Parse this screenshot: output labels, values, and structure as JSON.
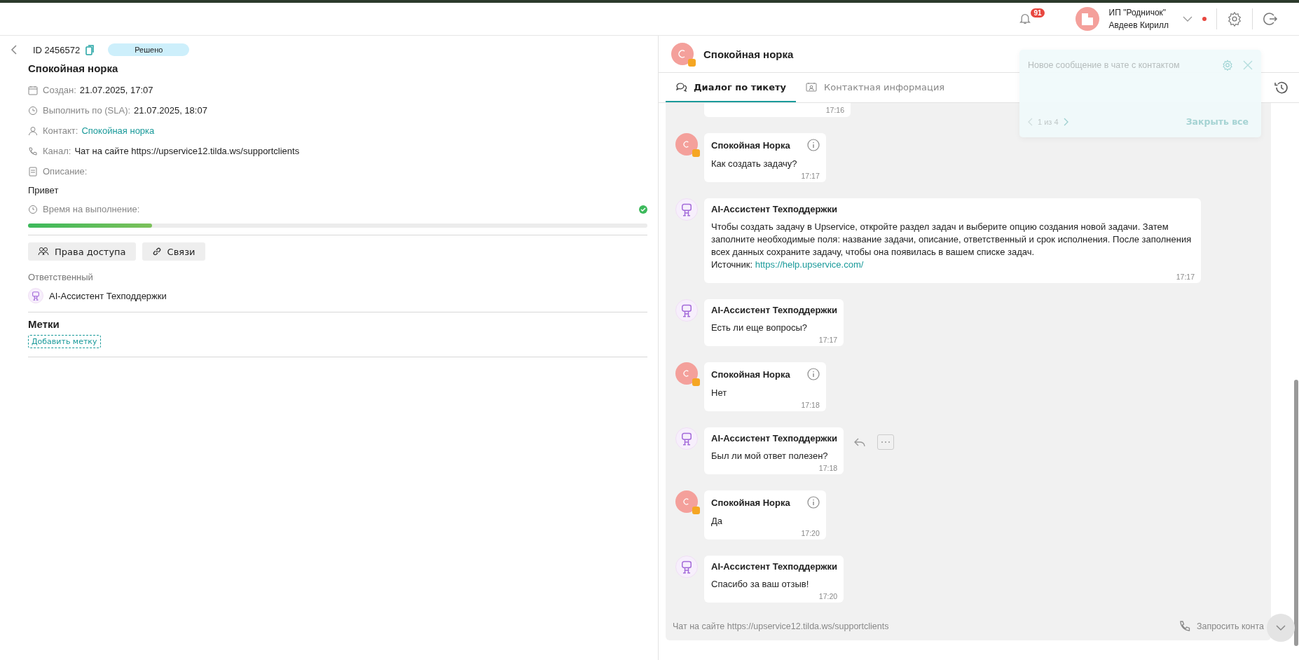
{
  "header": {
    "notifications": "91",
    "company": "ИП \"Родничок\"",
    "user": "Авдеев Кирилл",
    "online": true
  },
  "ticket": {
    "id": "ID 2456572",
    "status": "Решено",
    "title": "Спокойная норка",
    "fields": [
      {
        "label": "Создан:",
        "value": "21.07.2025, 17:07",
        "link": false
      },
      {
        "label": "Выполнить по (SLA):",
        "value": "21.07.2025, 18:07",
        "link": false
      },
      {
        "label": "Контакт:",
        "value": "Спокойная норка",
        "link": true
      },
      {
        "label": "Канал:",
        "value": "Чат на сайте https://upservice12.tilda.ws/supportclients",
        "link": false
      },
      {
        "label": "Описание:"
      }
    ],
    "description": "Привет",
    "progress": {
      "label": "Время на выполнение:",
      "done": true,
      "level": 0.2
    },
    "buttons": [
      "Права доступа",
      "Связи"
    ],
    "responsible_label": "Ответственный",
    "responsible": "AI-Ассистент Техподдержки",
    "tags_title": "Метки",
    "add_tag": "Добавить метку"
  },
  "chat": {
    "contact": "Спокойная норка",
    "tabs": [
      {
        "label": "Диалог по тикету",
        "selected": true
      },
      {
        "label": "Контактная информация",
        "selected": false
      }
    ],
    "messages": [
      {
        "kind": "partial",
        "time": "17:16"
      },
      {
        "kind": "contact",
        "name": "Спокойная Норка",
        "text": "Как создать задачу?",
        "time": "17:17"
      },
      {
        "kind": "ai",
        "name": "AI-Ассистент Техподдержки",
        "text": "Чтобы создать задачу в Upservice, откройте раздел задач и выберите опцию создания новой задачи. Затем заполните необходимые поля: название задачи, описание, ответственный и срок исполнения. После заполнения всех данных сохраните задачу, чтобы она появилась в вашем списке задач.",
        "source_label": "Источник:",
        "source": "https://help.upservice.com/",
        "time": "17:17"
      },
      {
        "kind": "ai",
        "name": "AI-Ассистент Техподдержки",
        "text": "Есть ли еще вопросы?",
        "time": "17:17"
      },
      {
        "kind": "contact",
        "name": "Спокойная Норка",
        "text": "Нет",
        "time": "17:18"
      },
      {
        "kind": "ai",
        "name": "AI-Ассистент Техподдержки",
        "text": "Был ли мой ответ полезен?",
        "time": "17:18",
        "actions": true
      },
      {
        "kind": "contact",
        "name": "Спокойная Норка",
        "text": "Да",
        "time": "17:20"
      },
      {
        "kind": "ai",
        "name": "AI-Ассистент Техподдержки",
        "text": "Спасибо за ваш отзыв!",
        "time": "17:20"
      }
    ],
    "channel": "Чат на сайте https://upservice12.tilda.ws/supportclients",
    "request_contact": "Запросить конта"
  },
  "notification": {
    "text": "Новое сообщение в чате с контактом",
    "counter": "1 из 4",
    "close_all": "Закрыть все"
  }
}
